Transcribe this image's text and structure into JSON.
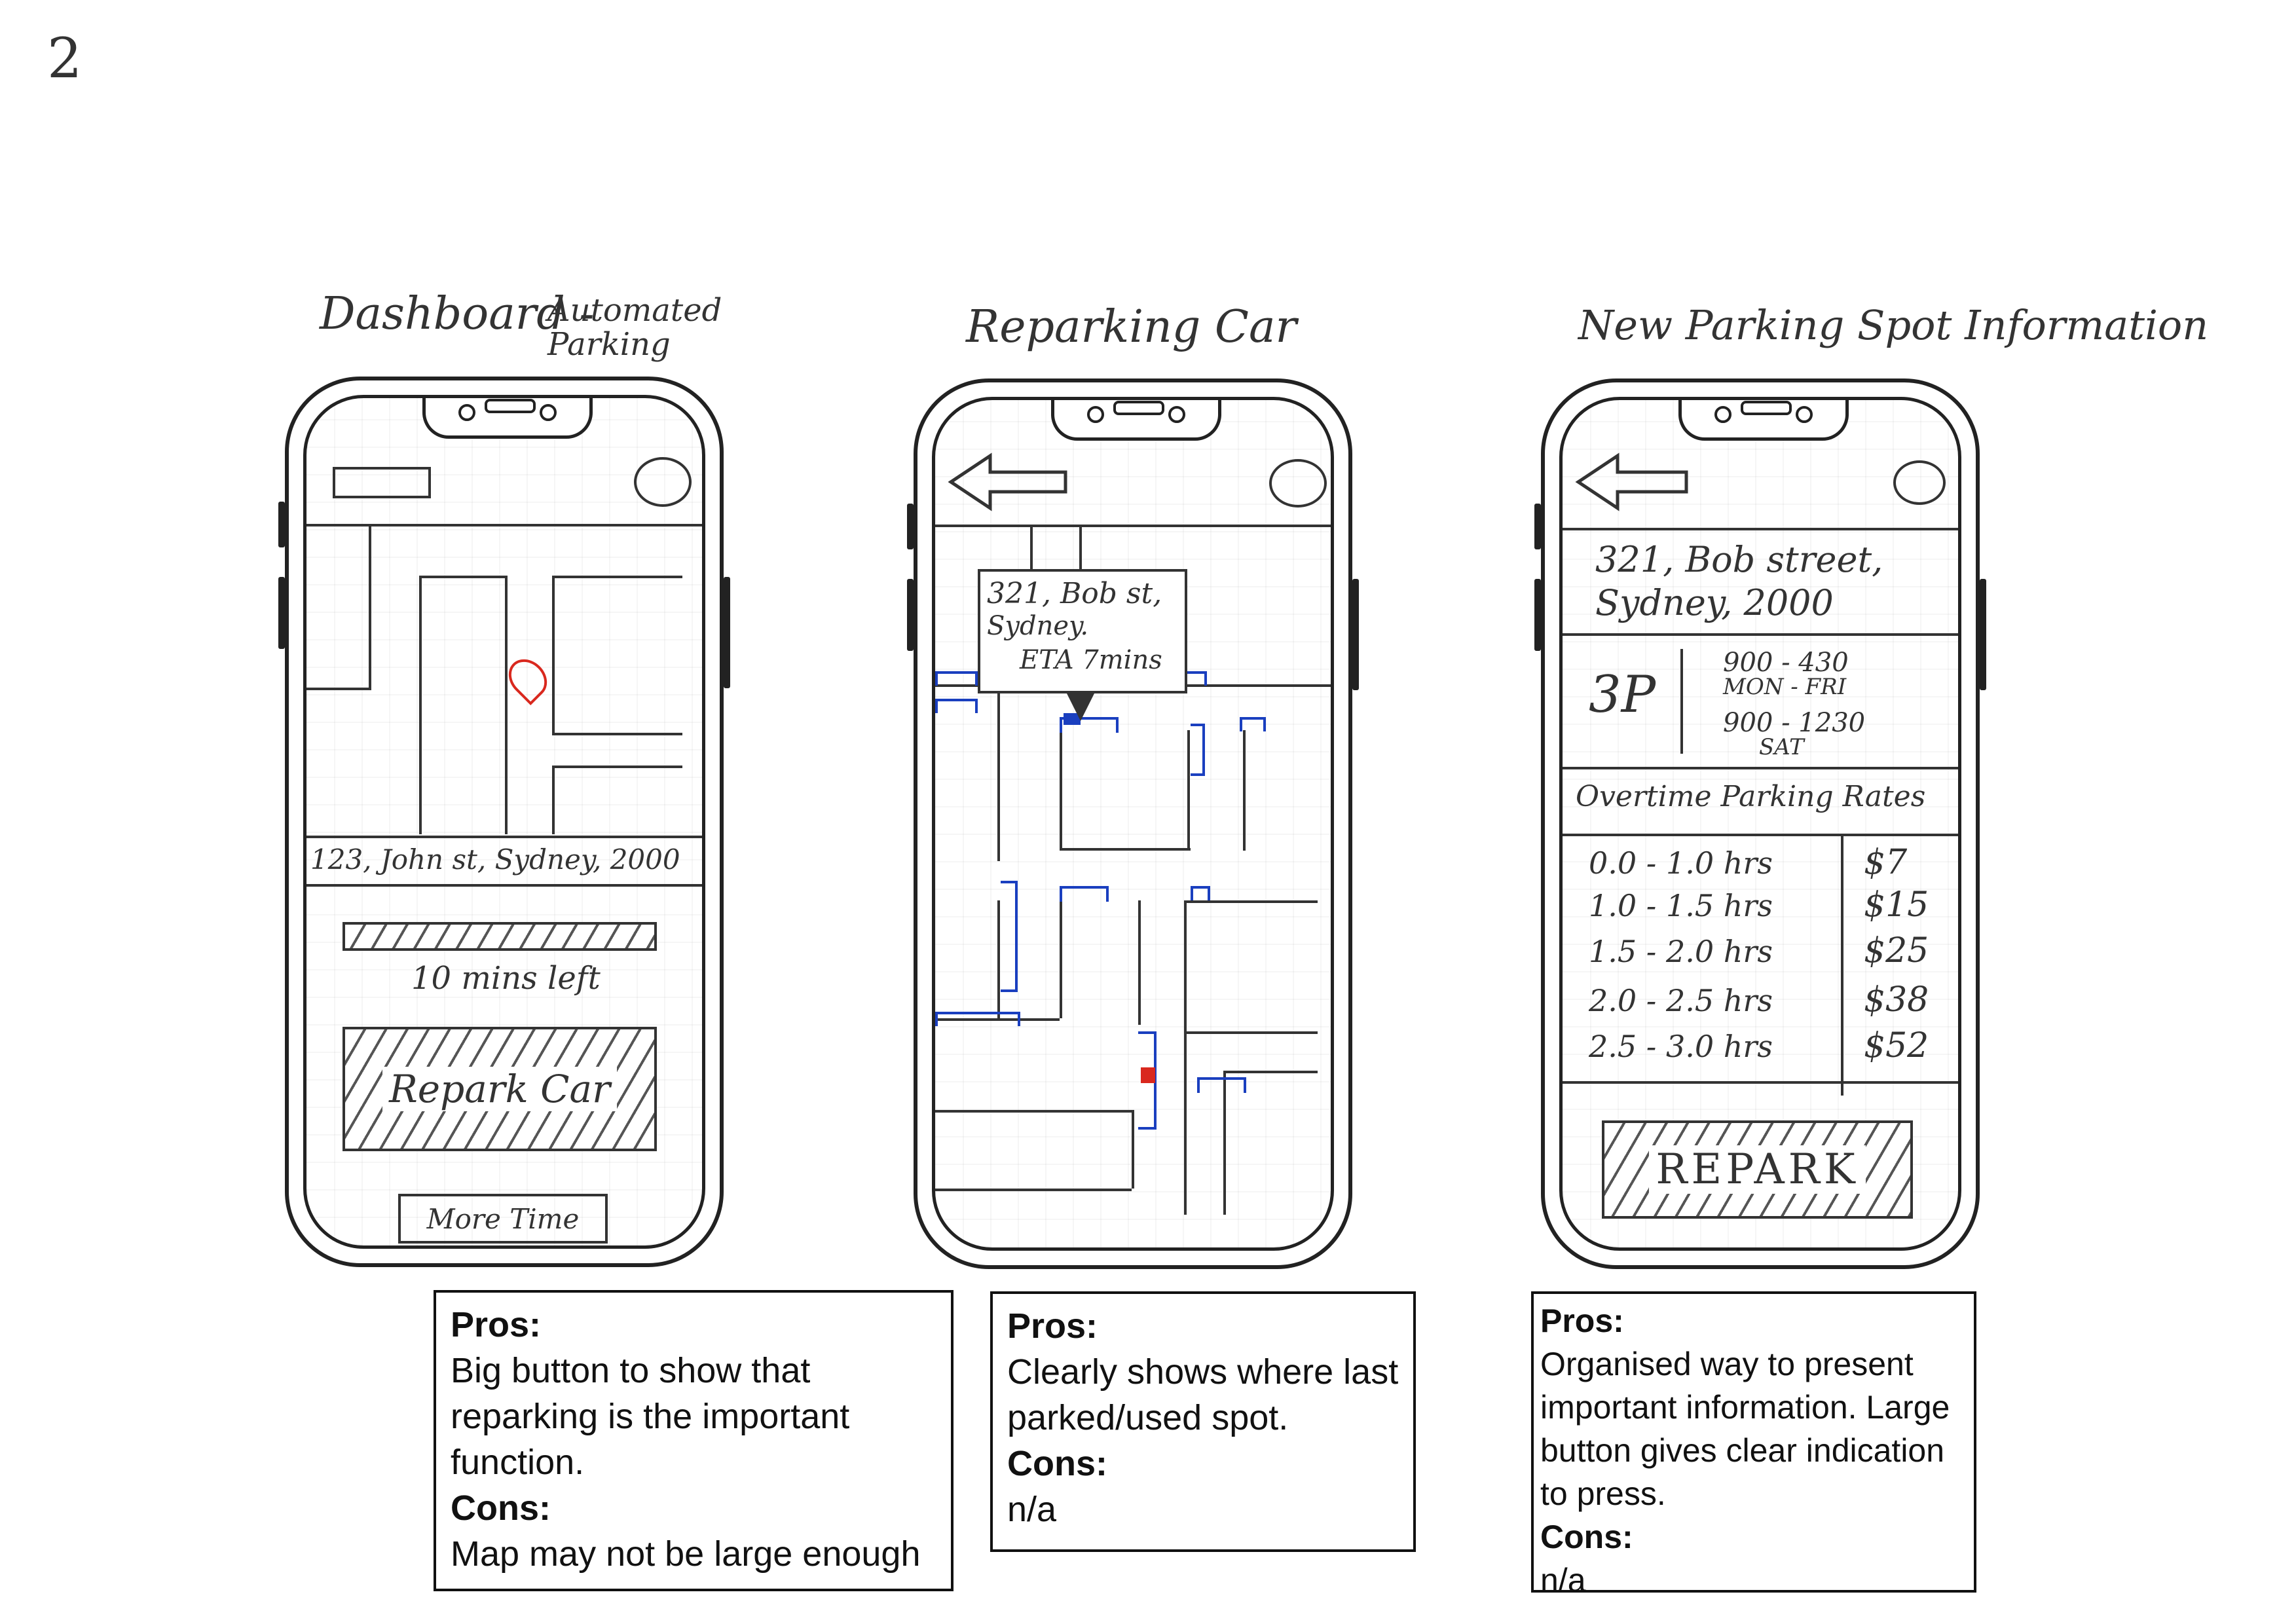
{
  "page_number": "2",
  "screens": [
    {
      "title": "Dashboard -",
      "title_extra": "Automated Parking",
      "address": "123, John st, Sydney, 2000",
      "progress_text": "10 mins left",
      "primary_button": "Repark Car",
      "secondary_button": "More Time"
    },
    {
      "title": "Reparking Car",
      "callout_line1": "321, Bob st,",
      "callout_line2": "Sydney.",
      "callout_line3": "ETA 7mins"
    },
    {
      "title": "New Parking Spot Information",
      "address_line1": "321, Bob street,",
      "address_line2": "Sydney, 2000",
      "zone": "3P",
      "hours": [
        "900 - 430",
        "MON - FRI",
        "900 - 1230",
        "SAT"
      ],
      "rates_heading": "Overtime Parking Rates",
      "rates": [
        {
          "duration": "0.0 - 1.0 hrs",
          "price": "$7"
        },
        {
          "duration": "1.0 - 1.5 hrs",
          "price": "$15"
        },
        {
          "duration": "1.5 - 2.0 hrs",
          "price": "$25"
        },
        {
          "duration": "2.0 - 2.5 hrs",
          "price": "$38"
        },
        {
          "duration": "2.5 - 3.0 hrs",
          "price": "$52"
        }
      ],
      "primary_button": "REPARK"
    }
  ],
  "notes": [
    {
      "pros_label": "Pros:",
      "pros": "Big button to show that reparking is the important function.",
      "cons_label": "Cons:",
      "cons": "Map may not be large enough"
    },
    {
      "pros_label": "Pros:",
      "pros": "Clearly shows where last parked/used spot.",
      "cons_label": "Cons:",
      "cons": "n/a"
    },
    {
      "pros_label": "Pros:",
      "pros": "Organised way to present important information. Large button gives clear indication to press.",
      "cons_label": "Cons:",
      "cons": "n/a"
    }
  ],
  "colors": {
    "pin": "#d9281e",
    "spots": "#1a3fbf",
    "ink": "#333333"
  }
}
